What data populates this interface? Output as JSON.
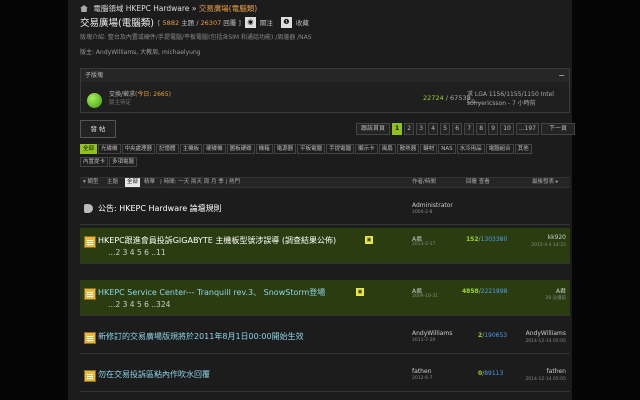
{
  "breadcrumb": {
    "root": "電腦領域 HKEPC Hardware",
    "sep": "»",
    "current": "交易廣場(電腦類)"
  },
  "forum": {
    "title": "交易廣場(電腦類)",
    "stats": {
      "open": "[",
      "topics": "5882",
      "topics_unit": "主題",
      "slash": "/",
      "posts": "26307",
      "posts_unit": "回覆",
      "close": "]"
    },
    "rss_label": "關注",
    "fav_label": "收藏",
    "desc": "版塊介紹: 整台及內置或硬件/手提電腦/平板電腦(包括含SIM 和通話功能) /周邊器 /NAS",
    "moderators": "版主: AndyWilliams, 大教周, michaelyung"
  },
  "subforum": {
    "header": "子版塊",
    "minus": "−",
    "name": "交換/徵求",
    "today": "(今日: 2665)",
    "mod": "版主待定",
    "threads": "22724",
    "sep": "/",
    "posts": "67538",
    "last_title": "求 LGA 1156/1155/1150 Intel Co...",
    "last_by": "sonyericsson - 7 小時前"
  },
  "post_button": "發 帖",
  "pager": {
    "first": "跟該首頁",
    "pages": [
      "1",
      "2",
      "3",
      "4",
      "5",
      "6",
      "7",
      "8",
      "9",
      "10",
      "...197"
    ],
    "next": "下一頁"
  },
  "categories": [
    "全部",
    "光碟機",
    "中央處理器",
    "記憶體",
    "主機板",
    "硬碟機",
    "圖板硬碟",
    "機箱",
    "電源器",
    "平板電腦",
    "手提電腦",
    "顯示卡",
    "風扇",
    "散熱器",
    "鍵材",
    "NAS",
    "水冷用品",
    "電腦組合",
    "其他",
    "內置提卡",
    "多項電腦"
  ],
  "thead": {
    "type": "▾ 類型",
    "topic": "主題",
    "all": "全部",
    "ess": "精華",
    "time": "| 時間: 一天 兩天 周 月 季 | 熱門",
    "author": "作者/時間",
    "replies": "回覆 查看",
    "last": "最後發表 ▸"
  },
  "threads": [
    {
      "title": "公告: HKEPC Hardware 論壇規則",
      "pages": "",
      "author": "Administrator",
      "date": "2004-2-8",
      "replies": "",
      "views": "",
      "last": "",
      "ldate": "",
      "badge": ""
    },
    {
      "title": "HKEPC跟進會員投訴GIGABYTE 主機板型號涉誤導 (調查結果公佈)",
      "pages": "…2 3 4 5 6 ..11",
      "author": "A君",
      "date": "2013-2-17",
      "replies": "152",
      "views": "1303380",
      "last": "kk920",
      "ldate": "2015-4-4 14:25",
      "badge": "▣"
    },
    {
      "title": "HKEPC Service Center--- Tranquill rev.3、 SnowStorm登場",
      "pages": "…2 3 4 5 6 ..324",
      "author": "A君",
      "date": "2009-10-31",
      "replies": "4858",
      "views": "2221898",
      "last": "A君",
      "ldate": "28 分鐘前",
      "badge": "▣"
    },
    {
      "title": "新修訂的交易廣場版規將於2011年8月1日00:00開始生效",
      "pages": "",
      "author": "AndyWilliams",
      "date": "2011-7-29",
      "replies": "2",
      "views": "190653",
      "last": "AndyWilliams",
      "ldate": "2014-12-14 05:05",
      "badge": ""
    },
    {
      "title": "勿在交易投訴區粘內作吹水回覆",
      "pages": "",
      "author": "fathen",
      "date": "2012-6-7",
      "replies": "0",
      "views": "89113",
      "last": "fathen",
      "ldate": "2014-12-14 05:05",
      "badge": ""
    }
  ]
}
